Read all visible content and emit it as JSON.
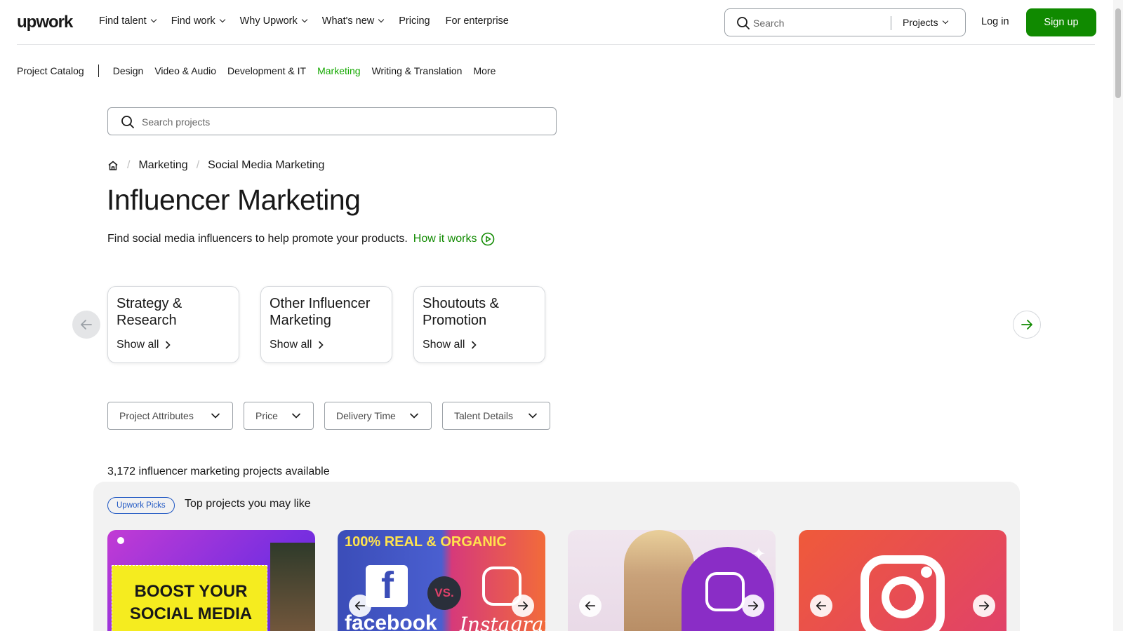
{
  "header": {
    "logo": "upwork",
    "nav": [
      {
        "label": "Find talent",
        "dropdown": true
      },
      {
        "label": "Find work",
        "dropdown": true
      },
      {
        "label": "Why Upwork",
        "dropdown": true
      },
      {
        "label": "What's new",
        "dropdown": true
      },
      {
        "label": "Pricing",
        "dropdown": false
      },
      {
        "label": "For enterprise",
        "dropdown": false
      }
    ],
    "search_placeholder": "Search",
    "search_scope": "Projects",
    "login": "Log in",
    "signup": "Sign up",
    "signup_color": "#108a00"
  },
  "category_nav": {
    "catalog": "Project Catalog",
    "items": [
      "Design",
      "Video & Audio",
      "Development & IT",
      "Marketing",
      "Writing & Translation",
      "More"
    ],
    "active": "Marketing",
    "active_color": "#14a800"
  },
  "project_search": {
    "placeholder": "Search projects"
  },
  "breadcrumb": [
    "Marketing",
    "Social Media Marketing"
  ],
  "page_title": "Influencer Marketing",
  "subtitle": "Find social media influencers to help promote your products.",
  "how_it_works": "How it works",
  "subcategories": [
    {
      "name": "Strategy & Research",
      "action": "Show all"
    },
    {
      "name": "Other Influencer Marketing",
      "action": "Show all"
    },
    {
      "name": "Shoutouts & Promotion",
      "action": "Show all"
    }
  ],
  "filters": [
    "Project Attributes",
    "Price",
    "Delivery Time",
    "Talent Details"
  ],
  "results_count": "3,172 influencer marketing projects available",
  "picks": {
    "badge": "Upwork Picks",
    "title": "Top projects you may like",
    "cards": [
      {
        "image_text": "BOOST YOUR SOCIAL MEDIA"
      },
      {
        "image_text": "100% REAL & ORGANIC",
        "image_text_2": "facebook",
        "image_text_3": "VS.",
        "image_text_4": "Instagram"
      },
      {
        "image_text": ""
      },
      {
        "image_text": ""
      }
    ]
  }
}
